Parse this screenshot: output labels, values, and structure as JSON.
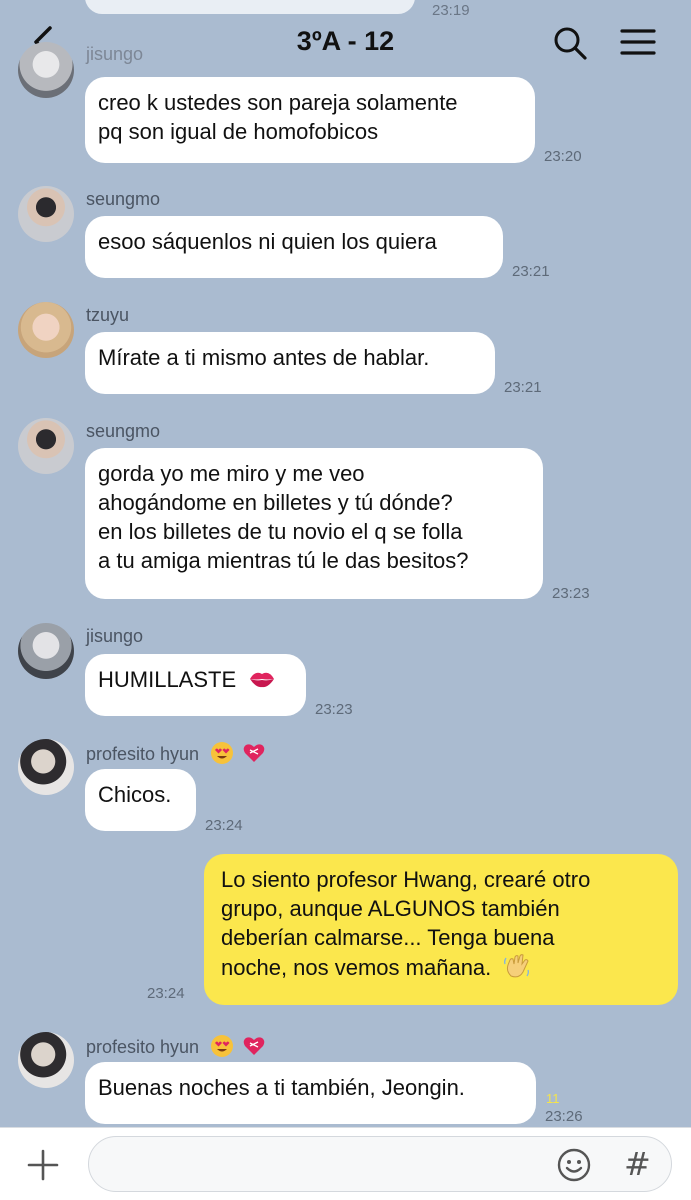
{
  "header": {
    "title": "3ºA - 12",
    "back_icon": "chevron-left-icon",
    "search_icon": "search-icon",
    "menu_icon": "hamburger-menu-icon"
  },
  "previous": {
    "time": "23:19"
  },
  "messages": [
    {
      "sender": "jisungo",
      "text": "creo k ustedes son pareja solamente\npq son igual de homofobicos",
      "time": "23:20"
    },
    {
      "sender": "seungmo",
      "text": "esoo sáquenlos ni quien los quiera",
      "time": "23:21"
    },
    {
      "sender": "tzuyu",
      "text": "Mírate a ti mismo antes de hablar.",
      "time": "23:21"
    },
    {
      "sender": "seungmo",
      "text": "gorda yo me miro y me veo\nahogándome en billetes y tú dónde?\nen los billetes de tu novio el q se folla\na tu amiga mientras tú le das besitos?",
      "time": "23:23"
    },
    {
      "sender": "jisungo",
      "text": "HUMILLASTE",
      "time": "23:23"
    },
    {
      "sender": "profesito hyun",
      "text": "Chicos.",
      "time": "23:24"
    },
    {
      "outgoing": true,
      "text": "Lo siento profesor Hwang, crearé otro\ngrupo, aunque ALGUNOS también\ndeberían calmarse... Tenga buena\nnoche, nos vemos mañana.",
      "time": "23:24"
    },
    {
      "sender": "profesito hyun",
      "text": "Buenas noches a ti también, Jeongin.",
      "time": "23:26",
      "read_count": "11"
    }
  ],
  "input": {
    "plus_icon": "plus-icon",
    "emoji_icon": "emoji-icon",
    "hash_label": "#"
  },
  "colors": {
    "background": "#aabbd0",
    "incoming_bubble": "#ffffff",
    "outgoing_bubble": "#fbe74d",
    "read_count": "#f5e44a"
  }
}
